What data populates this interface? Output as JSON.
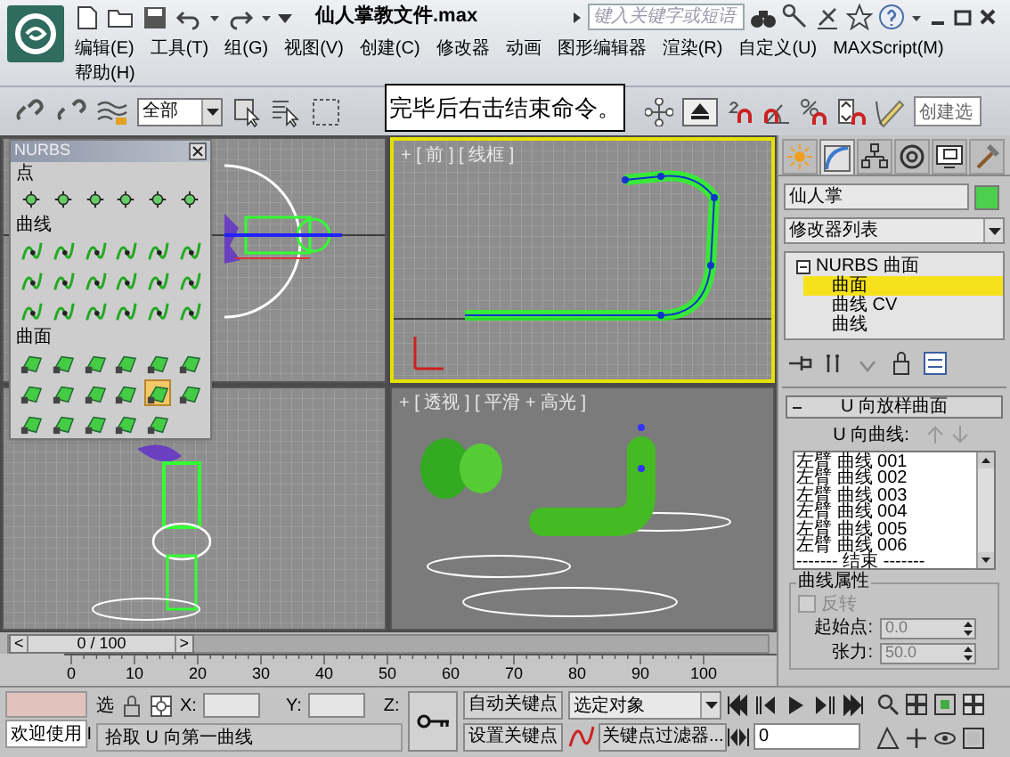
{
  "title_bar": {
    "title": "仙人掌教文件.max",
    "search": {
      "placeholder": "键入关键字或短语"
    }
  },
  "menu_rows": [
    [
      "编辑(E)",
      "工具(T)",
      "组(G)",
      "视图(V)",
      "创建(C)",
      "修改器",
      "动画",
      "图形编辑器",
      "渲染(R)",
      "自定义(U)",
      "MAXScript(M)"
    ],
    [
      "帮助(H)"
    ]
  ],
  "toolbar": {
    "selection_filter": "全部",
    "named_selection": "创建选"
  },
  "tooltip": "完毕后右击结束命令。",
  "viewports": [
    {
      "kind": "top",
      "active": false
    },
    {
      "kind": "front",
      "active": true,
      "label": "+ [ 前 ] [ 线框 ]"
    },
    {
      "kind": "left",
      "active": false
    },
    {
      "kind": "perspective",
      "active": false,
      "label": "+ [ 透视 ] [ 平滑 + 高光 ]"
    }
  ],
  "nurbs_panel": {
    "title": "NURBS",
    "sections": [
      {
        "kind": "point",
        "label": "点",
        "tools": [
          {
            "selected": false
          },
          {
            "selected": false
          },
          {
            "selected": false
          },
          {
            "selected": false
          },
          {
            "selected": false
          },
          {
            "selected": false
          }
        ]
      },
      {
        "kind": "curve",
        "label": "曲线",
        "tools": [
          {
            "selected": false
          },
          {
            "selected": false
          },
          {
            "selected": false
          },
          {
            "selected": false
          },
          {
            "selected": false
          },
          {
            "selected": false
          },
          {
            "selected": false
          },
          {
            "selected": false
          },
          {
            "selected": false
          },
          {
            "selected": false
          },
          {
            "selected": false
          },
          {
            "selected": false
          },
          {
            "selected": false
          },
          {
            "selected": false
          },
          {
            "selected": false
          },
          {
            "selected": false
          },
          {
            "selected": false
          },
          {
            "selected": false
          }
        ]
      },
      {
        "kind": "surface",
        "label": "曲面",
        "tools": [
          {
            "selected": false
          },
          {
            "selected": false
          },
          {
            "selected": false
          },
          {
            "selected": false
          },
          {
            "selected": false
          },
          {
            "selected": false
          },
          {
            "selected": false
          },
          {
            "selected": false
          },
          {
            "selected": false
          },
          {
            "selected": false
          },
          {
            "selected": true
          },
          {
            "selected": false
          },
          {
            "selected": false
          },
          {
            "selected": false
          },
          {
            "selected": false
          },
          {
            "selected": false
          },
          {
            "selected": false
          }
        ]
      }
    ]
  },
  "command_panel": {
    "tabs": [
      {
        "selected": false
      },
      {
        "selected": true
      },
      {
        "selected": false
      },
      {
        "selected": false
      },
      {
        "selected": false
      },
      {
        "selected": false
      }
    ],
    "object_name": "仙人掌",
    "modifier_list": "修改器列表",
    "stack": [
      {
        "label": "NURBS 曲面",
        "expanded": true,
        "selected": false,
        "children": [
          {
            "label": "曲面",
            "selected": true
          },
          {
            "label": "曲线 CV",
            "selected": false
          },
          {
            "label": "曲线",
            "selected": false
          }
        ]
      }
    ],
    "rollout": {
      "title": "U 向放样曲面",
      "expanded": true,
      "curves_label": "U 向曲线:",
      "curves": [
        "左臂 曲线 001",
        "左臂 曲线 002",
        "左臂 曲线 003",
        "左臂 曲线 004",
        "左臂 曲线 005",
        "左臂 曲线 006",
        "------- 结束 -------"
      ],
      "group": "曲线属性",
      "reverse": {
        "label": "反转",
        "checked": false,
        "disabled": true
      },
      "start_point": {
        "label": "起始点:",
        "value": "0.0"
      },
      "tension": {
        "label": "张力:",
        "value": "50.0"
      }
    }
  },
  "time_slider": {
    "prev": "<",
    "position": "0 / 100",
    "next": ">",
    "level": 0
  },
  "ruler": {
    "ticks": [
      "0",
      "10",
      "20",
      "30",
      "40",
      "50",
      "60",
      "70",
      "80",
      "90",
      "100"
    ]
  },
  "status": {
    "listener": "欢迎使用 I",
    "lock_label": "选",
    "x_label": "X:",
    "y_label": "Y:",
    "z_label": "Z:",
    "prompt": "拾取 U 向第一曲线",
    "auto_key": "自动关键点",
    "set_key": "设置关键点",
    "key_target": "选定对象",
    "key_filters": "关键点过滤器...",
    "frame": "0"
  }
}
